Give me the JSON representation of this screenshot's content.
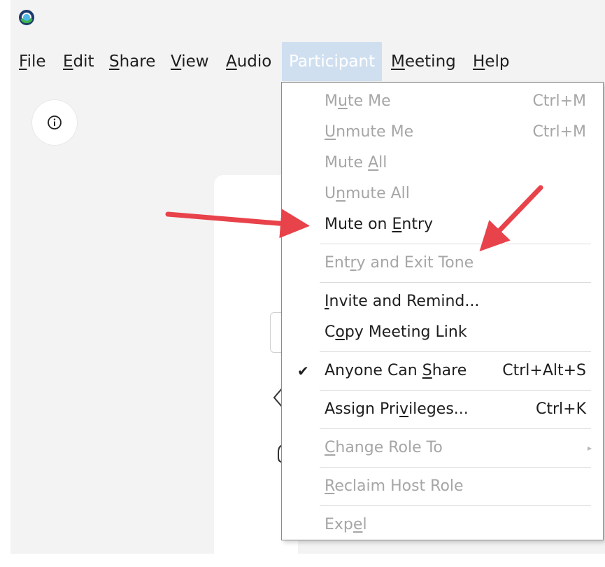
{
  "menubar": {
    "items": [
      {
        "pre": "",
        "ul": "F",
        "post": "ile"
      },
      {
        "pre": "",
        "ul": "E",
        "post": "dit"
      },
      {
        "pre": "",
        "ul": "S",
        "post": "hare"
      },
      {
        "pre": "",
        "ul": "V",
        "post": "iew"
      },
      {
        "pre": "",
        "ul": "A",
        "post": "udio"
      },
      {
        "pre": "",
        "ul": "",
        "post": "Participant"
      },
      {
        "pre": "",
        "ul": "M",
        "post": "eeting"
      },
      {
        "pre": "",
        "ul": "H",
        "post": "elp"
      }
    ],
    "active": "Participant"
  },
  "dropdown": {
    "items": [
      {
        "pre": "M",
        "ul": "u",
        "post": "te Me",
        "shortcut": "Ctrl+M",
        "disabled": true
      },
      {
        "pre": "",
        "ul": "U",
        "post": "nmute Me",
        "shortcut": "Ctrl+M",
        "disabled": true
      },
      {
        "pre": "Mute ",
        "ul": "A",
        "post": "ll",
        "shortcut": "",
        "disabled": true
      },
      {
        "pre": "U",
        "ul": "n",
        "post": "mute All",
        "shortcut": "",
        "disabled": true
      },
      {
        "pre": "Mute on ",
        "ul": "E",
        "post": "ntry",
        "shortcut": "",
        "disabled": false
      },
      {
        "pre": "Ent",
        "ul": "r",
        "post": "y and Exit Tone",
        "shortcut": "",
        "disabled": true
      },
      {
        "pre": "",
        "ul": "I",
        "post": "nvite and Remind...",
        "shortcut": "",
        "disabled": false
      },
      {
        "pre": "C",
        "ul": "o",
        "post": "py Meeting Link",
        "shortcut": "",
        "disabled": false
      },
      {
        "pre": "Anyone Can ",
        "ul": "S",
        "post": "hare",
        "shortcut": "Ctrl+Alt+S",
        "disabled": false,
        "checked": true
      },
      {
        "pre": "Assign Pri",
        "ul": "v",
        "post": "ileges...",
        "shortcut": "Ctrl+K",
        "disabled": false
      },
      {
        "pre": "",
        "ul": "C",
        "post": "hange Role To",
        "shortcut": "",
        "disabled": true,
        "submenu": true
      },
      {
        "pre": "",
        "ul": "R",
        "post": "eclaim Host Role",
        "shortcut": "",
        "disabled": true
      },
      {
        "pre": "Exp",
        "ul": "e",
        "post": "l",
        "shortcut": "",
        "disabled": true
      }
    ]
  },
  "icons": {
    "app_logo": "webex-logo-icon",
    "info": "info-icon",
    "check": "checkmark-icon",
    "submenu": "submenu-arrow-icon"
  },
  "colors": {
    "active_menu_bg": "#cfdff0",
    "annotation_arrow": "#e8424a",
    "disabled_text": "#a6a6a6"
  }
}
